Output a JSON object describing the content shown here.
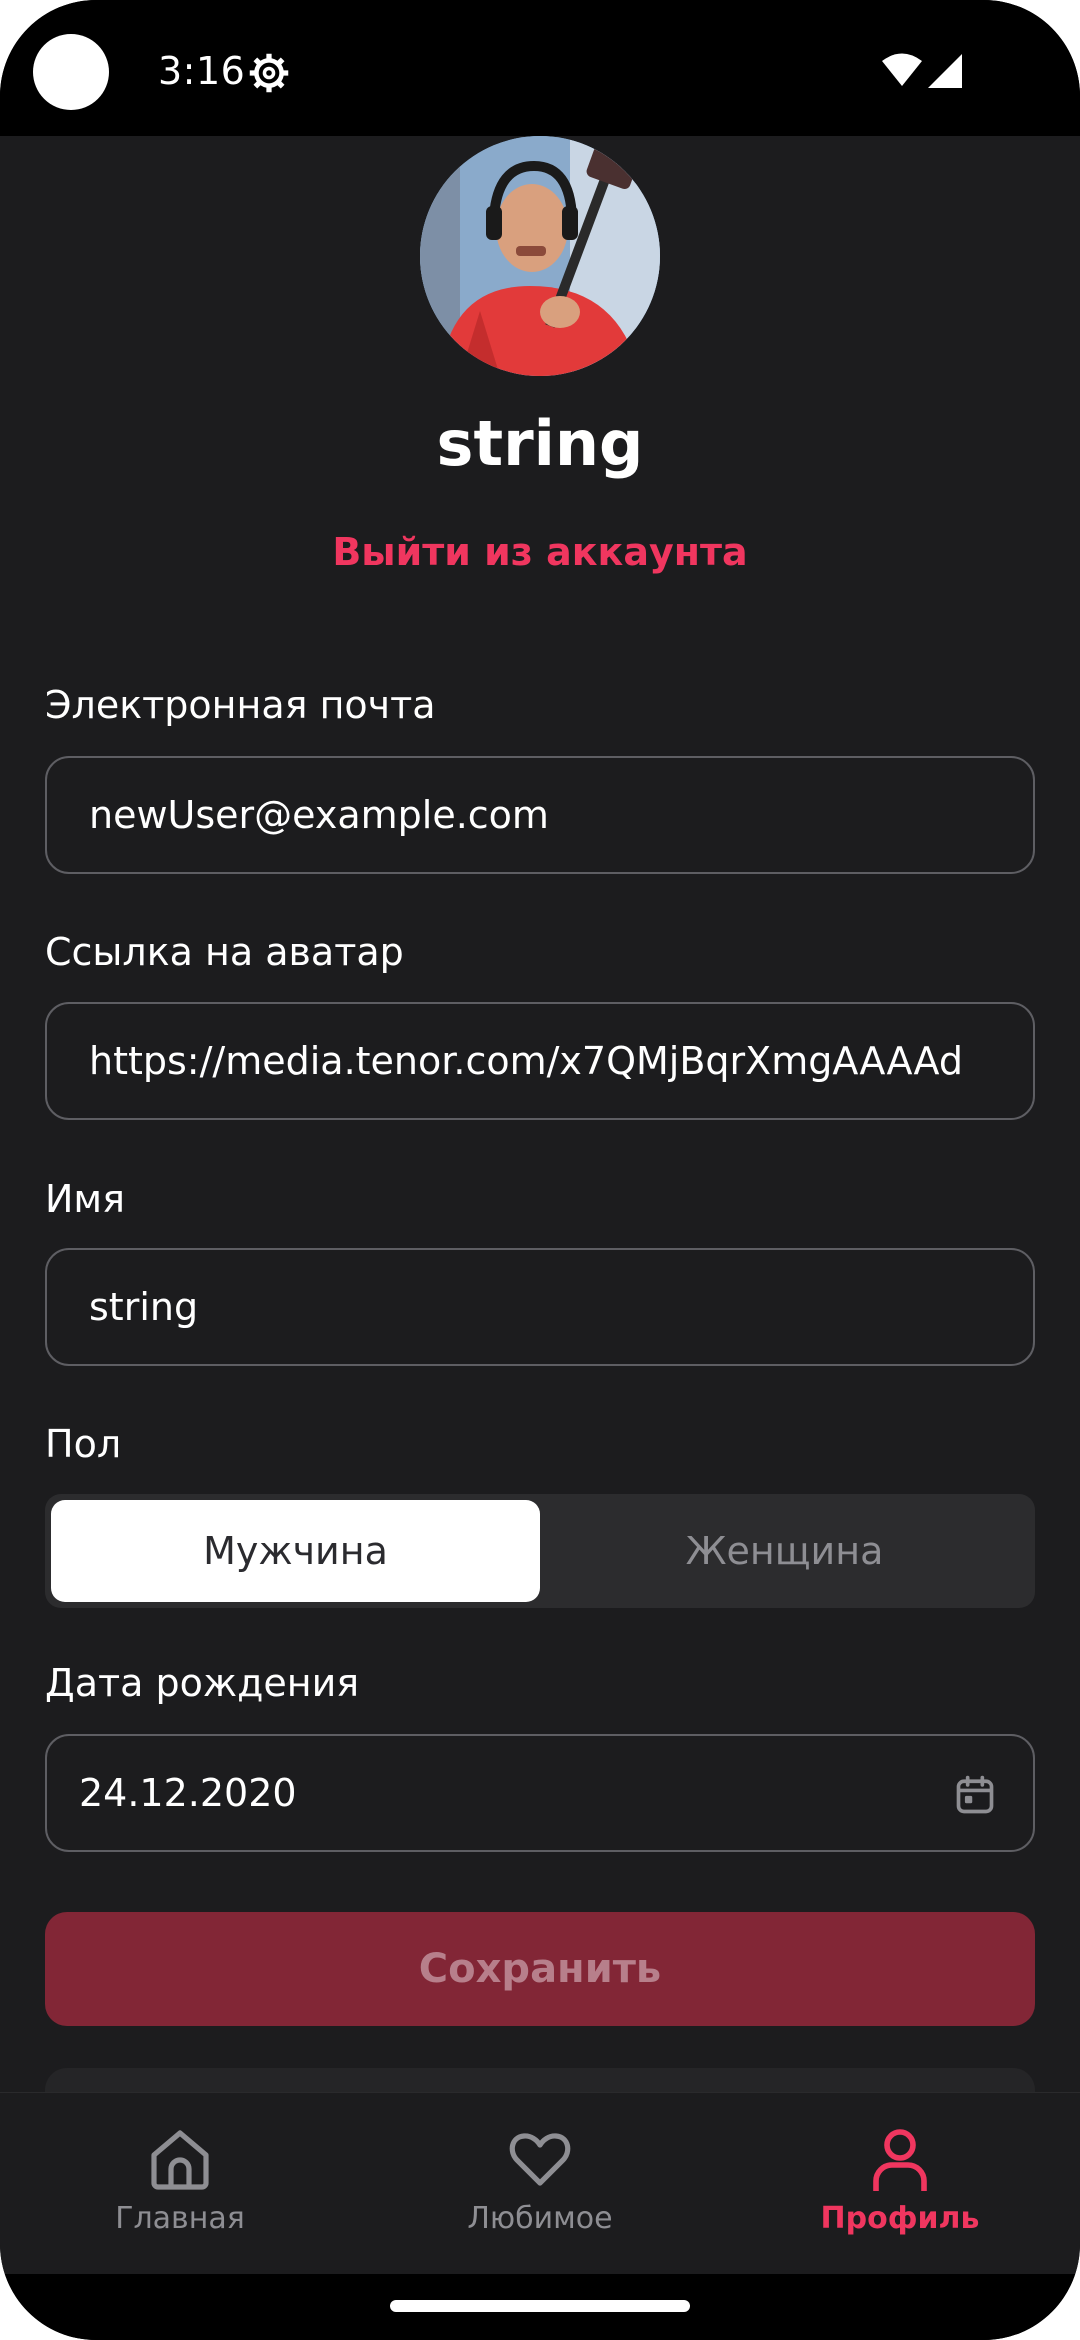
{
  "status_bar": {
    "time": "3:16",
    "icons": [
      "camera-dot",
      "gear-icon",
      "wifi-icon",
      "signal-icon"
    ]
  },
  "profile": {
    "username": "string",
    "logout_label": "Выйти из аккаунта"
  },
  "form": {
    "email": {
      "label": "Электронная почта",
      "value": "newUser@example.com"
    },
    "avatar_link": {
      "label": "Ссылка на аватар",
      "value": "https://media.tenor.com/x7QMjBqrXmgAAAAd"
    },
    "name": {
      "label": "Имя",
      "value": "string"
    },
    "gender": {
      "label": "Пол",
      "options": [
        "Мужчина",
        "Женщина"
      ],
      "selected": "Мужчина"
    },
    "birth_date": {
      "label": "Дата рождения",
      "value": "24.12.2020",
      "icon": "calendar-icon"
    },
    "save_label": "Сохранить"
  },
  "bottom_nav": {
    "items": [
      {
        "label": "Главная",
        "icon": "home-icon",
        "active": false
      },
      {
        "label": "Любимое",
        "icon": "heart-icon",
        "active": false
      },
      {
        "label": "Профиль",
        "icon": "person-icon",
        "active": true
      }
    ]
  },
  "colors": {
    "background": "#1c1c1e",
    "accent": "#f0365f",
    "save_button": "#822636",
    "field_border": "#5e5e63",
    "muted": "#8e8e93"
  }
}
